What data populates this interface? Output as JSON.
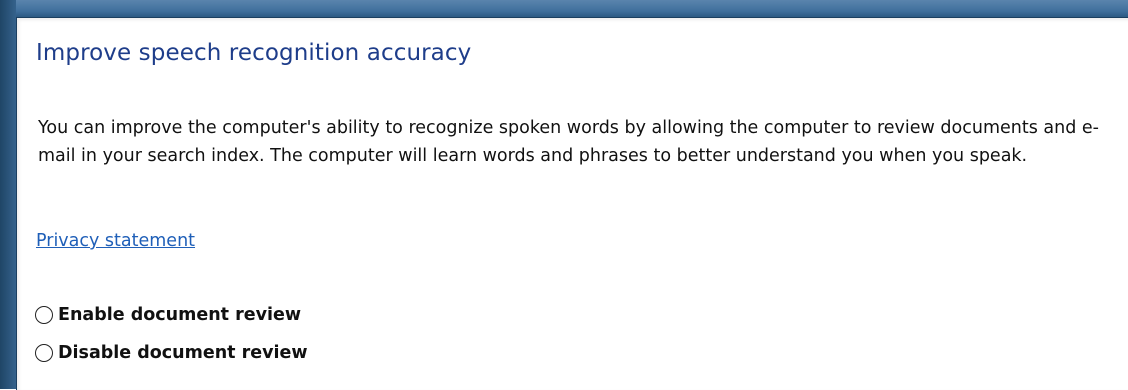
{
  "section": {
    "title": "Improve speech recognition accuracy",
    "description": "You can improve the computer's ability to recognize spoken words by allowing the computer to review documents and e-mail in your search index. The computer will learn words and phrases to better understand you when you speak.",
    "privacy_link": "Privacy statement"
  },
  "options": [
    {
      "label": "Enable document review",
      "selected": false
    },
    {
      "label": "Disable document review",
      "selected": false
    }
  ],
  "colors": {
    "frame": "#3f6f9c",
    "title": "#1e3d8a",
    "link": "#1f5fb8"
  }
}
